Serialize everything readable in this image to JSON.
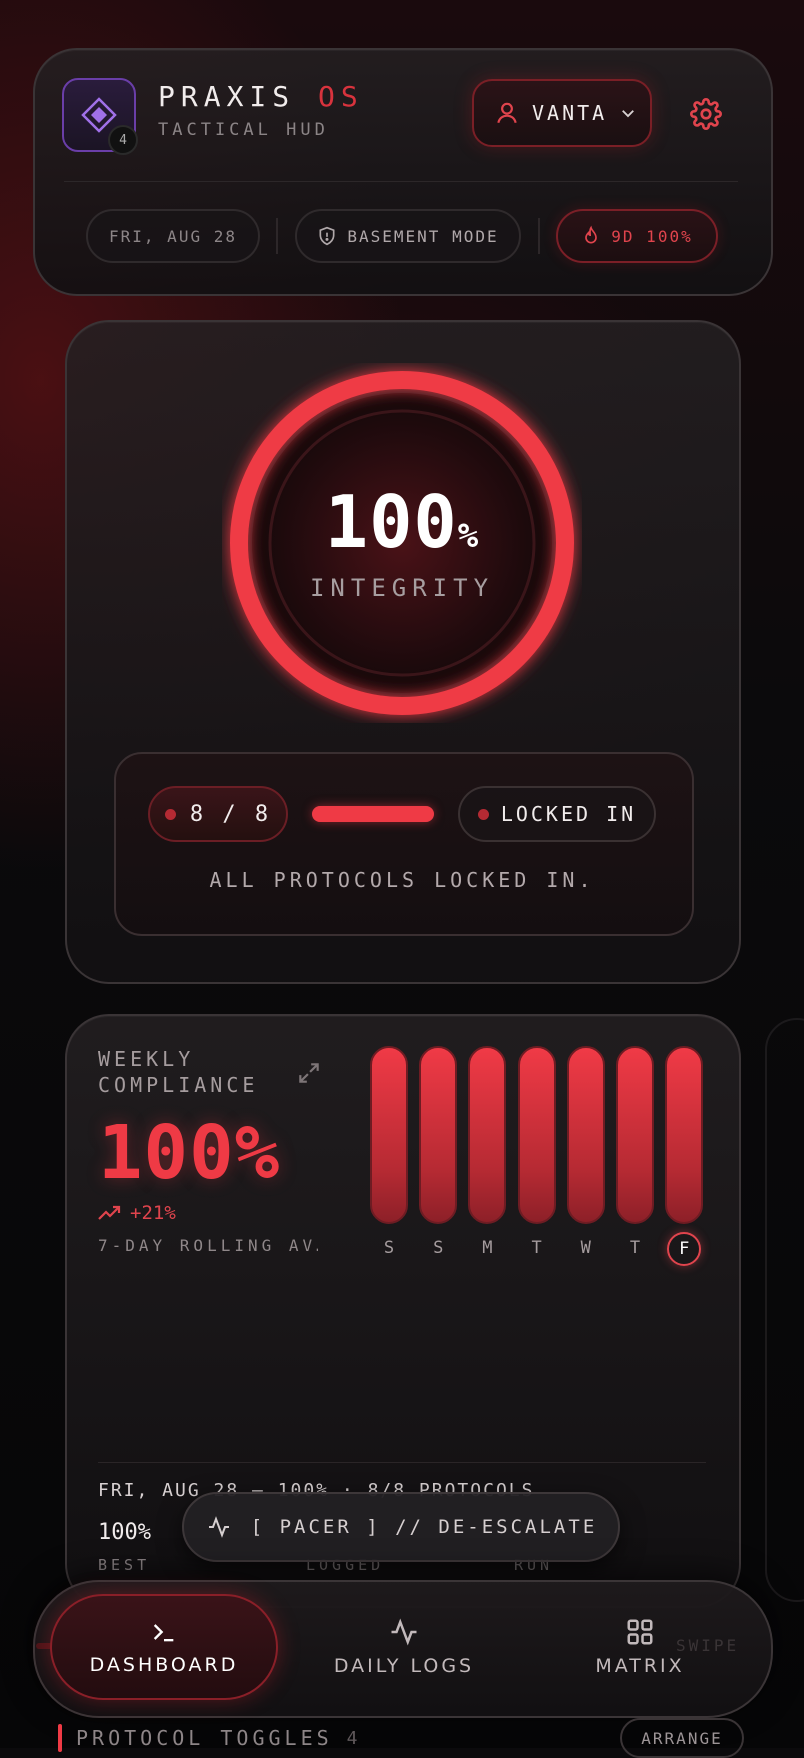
{
  "header": {
    "brand_main": "PRAXIS",
    "brand_accent": "OS",
    "subtitle": "TACTICAL HUD",
    "logo_badge": "4",
    "user_name": "VANTA",
    "date": "FRI, AUG 28",
    "mode": "BASEMENT MODE",
    "streak": "9D 100%"
  },
  "integrity": {
    "value": "100",
    "unit": "%",
    "label": "INTEGRITY",
    "fraction": 1.0,
    "protocols_count": "8 / 8",
    "progress": 1.0,
    "status": "LOCKED IN",
    "message": "ALL PROTOCOLS LOCKED IN."
  },
  "weekly": {
    "title": "WEEKLY COMPLIANCE",
    "value": "100%",
    "trend": "+21%",
    "avg_label": "7-DAY ROLLING AV…",
    "summary": "FRI, AUG 28 — 100% · 8/8 PROTOCOLS",
    "stats": [
      {
        "value": "100%",
        "label": "BEST"
      },
      {
        "value": "",
        "label": "LOGGED"
      },
      {
        "value": "",
        "label": "RUN"
      }
    ]
  },
  "chart_data": {
    "type": "bar",
    "categories": [
      "S",
      "S",
      "M",
      "T",
      "W",
      "T",
      "F"
    ],
    "values": [
      100,
      100,
      100,
      100,
      100,
      100,
      100
    ],
    "highlight_index": 6,
    "ylim": [
      0,
      100
    ]
  },
  "pacer": {
    "label": "[ PACER ] // DE-ESCALATE"
  },
  "nav": {
    "items": [
      {
        "label": "DASHBOARD",
        "icon": "terminal-icon",
        "active": true
      },
      {
        "label": "DAILY LOGS",
        "icon": "activity-icon",
        "active": false
      },
      {
        "label": "MATRIX",
        "icon": "grid-icon",
        "active": false
      }
    ],
    "swipe_hint": "SWIPE"
  },
  "protocols": {
    "title": "PROTOCOL TOGGLES",
    "count": "4",
    "arrange": "ARRANGE"
  },
  "colors": {
    "accent": "#ef3a45",
    "accent_dark": "#b62a33",
    "logo": "#8a5ad6",
    "background": "#0b0a0c"
  }
}
